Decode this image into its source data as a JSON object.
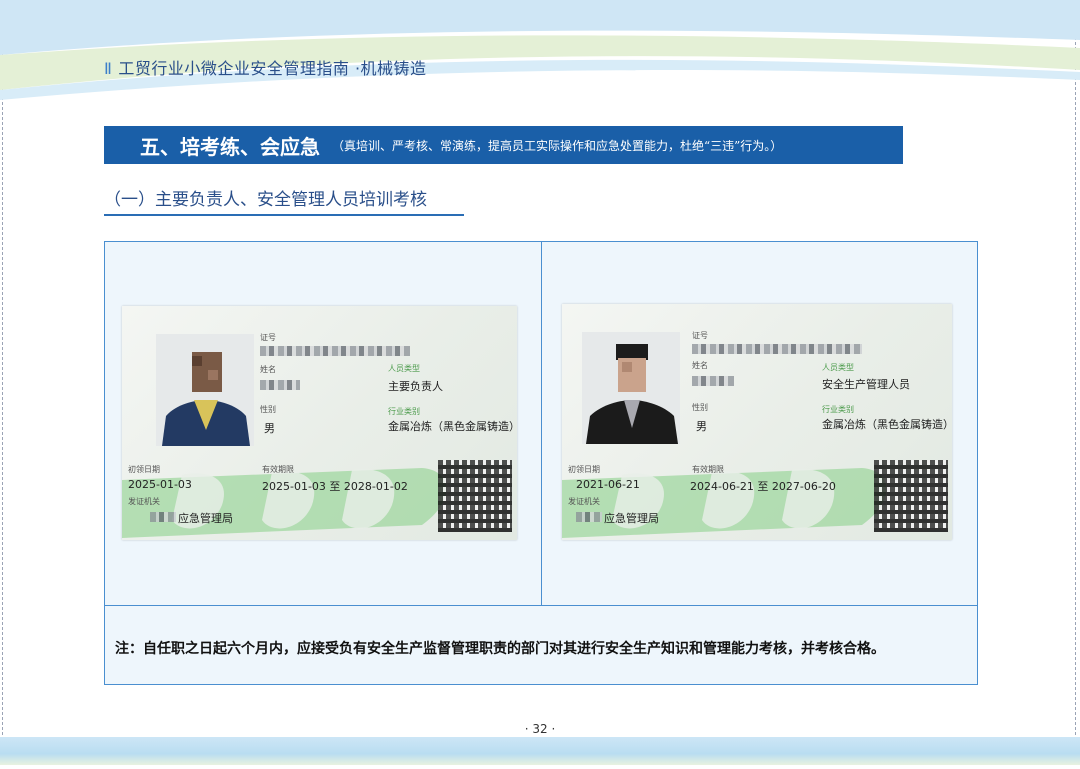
{
  "header": {
    "marker": "Ⅱ",
    "title": "工贸行业小微企业安全管理指南 ·机械铸造"
  },
  "section": {
    "title": "五、培考练、会应急",
    "subtitle": "（真培训、严考核、常演练，提高员工实际操作和应急处置能力，杜绝“三违”行为。）"
  },
  "subsection": {
    "title": "（一）主要负责人、安全管理人员培训考核"
  },
  "cards": [
    {
      "label_cert_no": "证号",
      "label_name": "姓名",
      "label_person_type": "人员类型",
      "person_type": "主要负责人",
      "label_gender": "性别",
      "gender": "男",
      "label_industry": "行业类别",
      "industry": "金属冶炼（黑色金属铸造）",
      "label_issue_date": "初领日期",
      "issue_date": "2025-01-03",
      "label_valid_period": "有效期限",
      "valid_period": "2025-01-03 至 2028-01-02",
      "label_issuer": "发证机关",
      "issuer": "应急管理局"
    },
    {
      "label_cert_no": "证号",
      "label_name": "姓名",
      "label_person_type": "人员类型",
      "person_type": "安全生产管理人员",
      "label_gender": "性别",
      "gender": "男",
      "label_industry": "行业类别",
      "industry": "金属冶炼（黑色金属铸造）",
      "label_issue_date": "初领日期",
      "issue_date": "2021-06-21",
      "label_valid_period": "有效期限",
      "valid_period": "2024-06-21 至 2027-06-20",
      "label_issuer": "发证机关",
      "issuer": "应急管理局"
    }
  ],
  "note": "注：自任职之日起六个月内，应接受负有安全生产监督管理职责的部门对其进行安全生产知识和管理能力考核，并考核合格。",
  "page_number": "· 32 ·",
  "colors": {
    "banner": "#1a5fa8",
    "header_text": "#2a4f8a",
    "panel_border": "#4a8fd0"
  }
}
